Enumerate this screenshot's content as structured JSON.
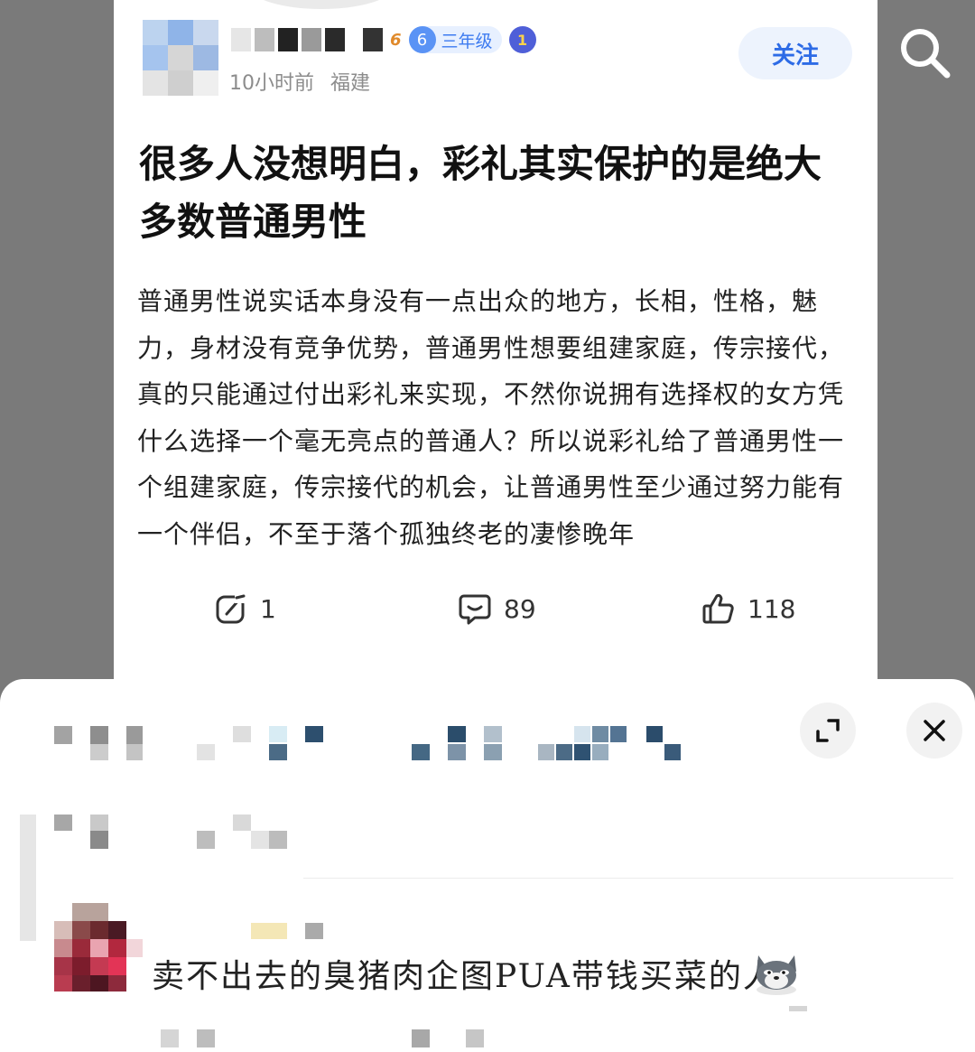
{
  "post": {
    "meta_time": "10小时前",
    "meta_location": "福建",
    "level_number": "6",
    "level_label": "三年级",
    "medal_number": "1",
    "name_level": "6",
    "follow_label": "关注",
    "title": "很多人没想明白，彩礼其实保护的是绝大多数普通男性",
    "body": "普通男性说实话本身没有一点出众的地方，长相，性格，魅力，身材没有竞争优势，普通男性想要组建家庭，传宗接代，真的只能通过付出彩礼来实现，不然你说拥有选择权的女方凭什么选择一个毫无亮点的普通人？所以说彩礼给了普通男性一个组建家庭，传宗接代的机会，让普通男性至少通过努力能有一个伴侣，不至于落个孤独终老的凄惨晚年",
    "actions": {
      "repost_count": "1",
      "comment_count": "89",
      "like_count": "118"
    }
  },
  "comment_sheet": {
    "comment_text": "卖不出去的臭猪肉企图PUA带钱买菜的人"
  },
  "icons": {
    "search": "search-icon",
    "repost": "repost-icon",
    "comment": "comment-bubble-icon",
    "like": "thumbs-up-icon",
    "expand": "expand-icon",
    "close": "close-icon",
    "wolf_emoji": "wolf-emoji-icon"
  },
  "colors": {
    "follow_text": "#2d6be6",
    "follow_bg": "#edf3fd",
    "level_accent": "#3d7bf0",
    "backdrop": "#7a7a7a"
  }
}
